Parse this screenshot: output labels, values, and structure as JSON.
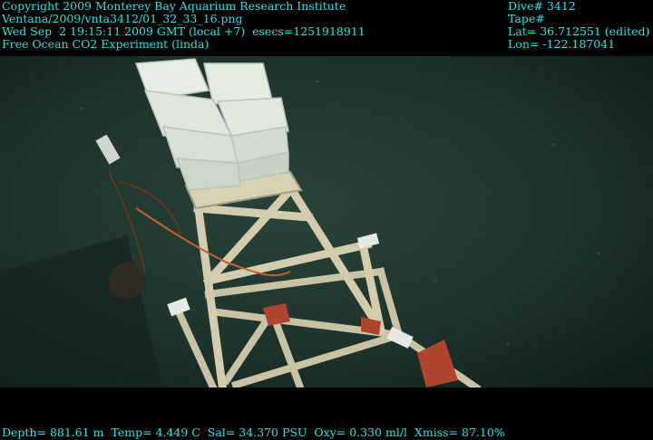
{
  "overlay": {
    "copyright": "Copyright 2009 Monterey Bay Aquarium Research Institute",
    "file_path": "Ventana/2009/vnta3412/01_32_33_16.png",
    "timestamp": "Wed Sep  2 19:15:11 2009 GMT (local +7)  esecs=1251918911",
    "experiment": "Free Ocean CO2 Experiment (linda)",
    "dive": "Dive# 3412",
    "tape": "Tape#",
    "lat": "Lat= 36.712551 (edited)",
    "lon": "Lon= -122.187041",
    "sensors": "Depth= 881.61 m  Temp= 4.449 C  Sal= 34.370 PSU  Oxy= 0.330 ml/l  Xmiss= 87.10%"
  },
  "colors": {
    "overlay_text": "#1ee6e6",
    "water": "#1b3029",
    "frame_wood": "#c9c3a6",
    "foam_block": "#e4ece2",
    "red_plate": "#b0452f"
  }
}
